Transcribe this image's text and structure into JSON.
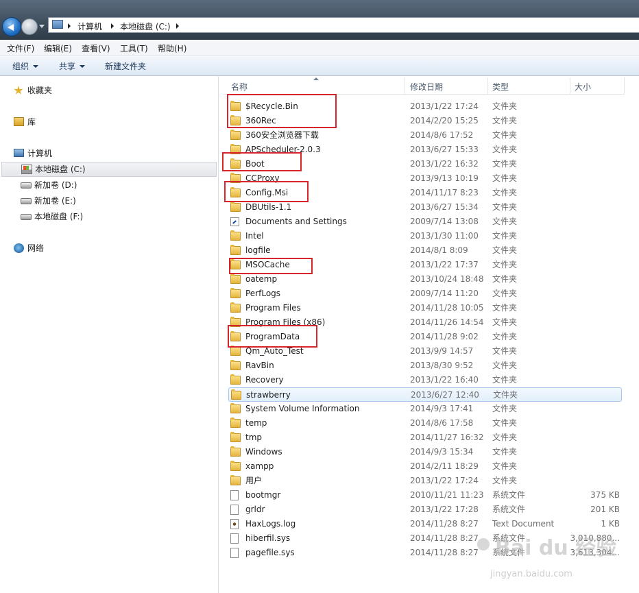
{
  "breadcrumb": [
    "计算机",
    "本地磁盘 (C:)"
  ],
  "menu": [
    "文件(F)",
    "编辑(E)",
    "查看(V)",
    "工具(T)",
    "帮助(H)"
  ],
  "toolbar": {
    "organize": "组织",
    "share": "共享",
    "new_folder": "新建文件夹"
  },
  "nav": {
    "favorites": "收藏夹",
    "libraries": "库",
    "computer": "计算机",
    "drives": [
      "本地磁盘 (C:)",
      "新加卷 (D:)",
      "新加卷 (E:)",
      "本地磁盘 (F:)"
    ],
    "network": "网络"
  },
  "columns": {
    "name": "名称",
    "date": "修改日期",
    "type": "类型",
    "size": "大小"
  },
  "files": [
    {
      "name": "$Recycle.Bin",
      "date": "2013/1/22 17:24",
      "type": "文件夹",
      "size": "",
      "icon": "folder"
    },
    {
      "name": "360Rec",
      "date": "2014/2/20 15:25",
      "type": "文件夹",
      "size": "",
      "icon": "folder"
    },
    {
      "name": "360安全浏览器下载",
      "date": "2014/8/6 17:52",
      "type": "文件夹",
      "size": "",
      "icon": "folder"
    },
    {
      "name": "APScheduler-2.0.3",
      "date": "2013/6/27 15:33",
      "type": "文件夹",
      "size": "",
      "icon": "folder"
    },
    {
      "name": "Boot",
      "date": "2013/1/22 16:32",
      "type": "文件夹",
      "size": "",
      "icon": "folder"
    },
    {
      "name": "CCProxy",
      "date": "2013/9/13 10:19",
      "type": "文件夹",
      "size": "",
      "icon": "folder"
    },
    {
      "name": "Config.Msi",
      "date": "2014/11/17 8:23",
      "type": "文件夹",
      "size": "",
      "icon": "folder"
    },
    {
      "name": "DBUtils-1.1",
      "date": "2013/6/27 15:34",
      "type": "文件夹",
      "size": "",
      "icon": "folder"
    },
    {
      "name": "Documents and Settings",
      "date": "2009/7/14 13:08",
      "type": "文件夹",
      "size": "",
      "icon": "shortcut"
    },
    {
      "name": "Intel",
      "date": "2013/1/30 11:00",
      "type": "文件夹",
      "size": "",
      "icon": "folder"
    },
    {
      "name": "logfile",
      "date": "2014/8/1 8:09",
      "type": "文件夹",
      "size": "",
      "icon": "folder"
    },
    {
      "name": "MSOCache",
      "date": "2013/1/22 17:37",
      "type": "文件夹",
      "size": "",
      "icon": "folder"
    },
    {
      "name": "oatemp",
      "date": "2013/10/24 18:48",
      "type": "文件夹",
      "size": "",
      "icon": "folder"
    },
    {
      "name": "PerfLogs",
      "date": "2009/7/14 11:20",
      "type": "文件夹",
      "size": "",
      "icon": "folder"
    },
    {
      "name": "Program Files",
      "date": "2014/11/28 10:05",
      "type": "文件夹",
      "size": "",
      "icon": "folder"
    },
    {
      "name": "Program Files (x86)",
      "date": "2014/11/26 14:54",
      "type": "文件夹",
      "size": "",
      "icon": "folder"
    },
    {
      "name": "ProgramData",
      "date": "2014/11/28 9:02",
      "type": "文件夹",
      "size": "",
      "icon": "folder"
    },
    {
      "name": "Qm_Auto_Test",
      "date": "2013/9/9 14:57",
      "type": "文件夹",
      "size": "",
      "icon": "folder"
    },
    {
      "name": "RavBin",
      "date": "2013/8/30 9:52",
      "type": "文件夹",
      "size": "",
      "icon": "folder"
    },
    {
      "name": "Recovery",
      "date": "2013/1/22 16:40",
      "type": "文件夹",
      "size": "",
      "icon": "folder"
    },
    {
      "name": "strawberry",
      "date": "2013/6/27 12:40",
      "type": "文件夹",
      "size": "",
      "icon": "folder"
    },
    {
      "name": "System Volume Information",
      "date": "2014/9/3 17:41",
      "type": "文件夹",
      "size": "",
      "icon": "folder"
    },
    {
      "name": "temp",
      "date": "2014/8/6 17:58",
      "type": "文件夹",
      "size": "",
      "icon": "folder"
    },
    {
      "name": "tmp",
      "date": "2014/11/27 16:32",
      "type": "文件夹",
      "size": "",
      "icon": "folder"
    },
    {
      "name": "Windows",
      "date": "2014/9/3 15:34",
      "type": "文件夹",
      "size": "",
      "icon": "folder"
    },
    {
      "name": "xampp",
      "date": "2014/2/11 18:29",
      "type": "文件夹",
      "size": "",
      "icon": "folder"
    },
    {
      "name": "用户",
      "date": "2013/1/22 17:24",
      "type": "文件夹",
      "size": "",
      "icon": "folder"
    },
    {
      "name": "bootmgr",
      "date": "2010/11/21 11:23",
      "type": "系统文件",
      "size": "375 KB",
      "icon": "file"
    },
    {
      "name": "grldr",
      "date": "2013/1/22 17:28",
      "type": "系统文件",
      "size": "201 KB",
      "icon": "file"
    },
    {
      "name": "HaxLogs.log",
      "date": "2014/11/28 8:27",
      "type": "Text Document",
      "size": "1 KB",
      "icon": "log"
    },
    {
      "name": "hiberfil.sys",
      "date": "2014/11/28 8:27",
      "type": "系统文件",
      "size": "3,010,880...",
      "icon": "file"
    },
    {
      "name": "pagefile.sys",
      "date": "2014/11/28 8:27",
      "type": "系统文件",
      "size": "3,613,304...",
      "icon": "file"
    }
  ],
  "watermark": {
    "logo": "Bai du 经验",
    "url": "jingyan.baidu.com"
  },
  "colors": {
    "highlight_box": "#d6252c",
    "selection": "#cce8ff"
  }
}
